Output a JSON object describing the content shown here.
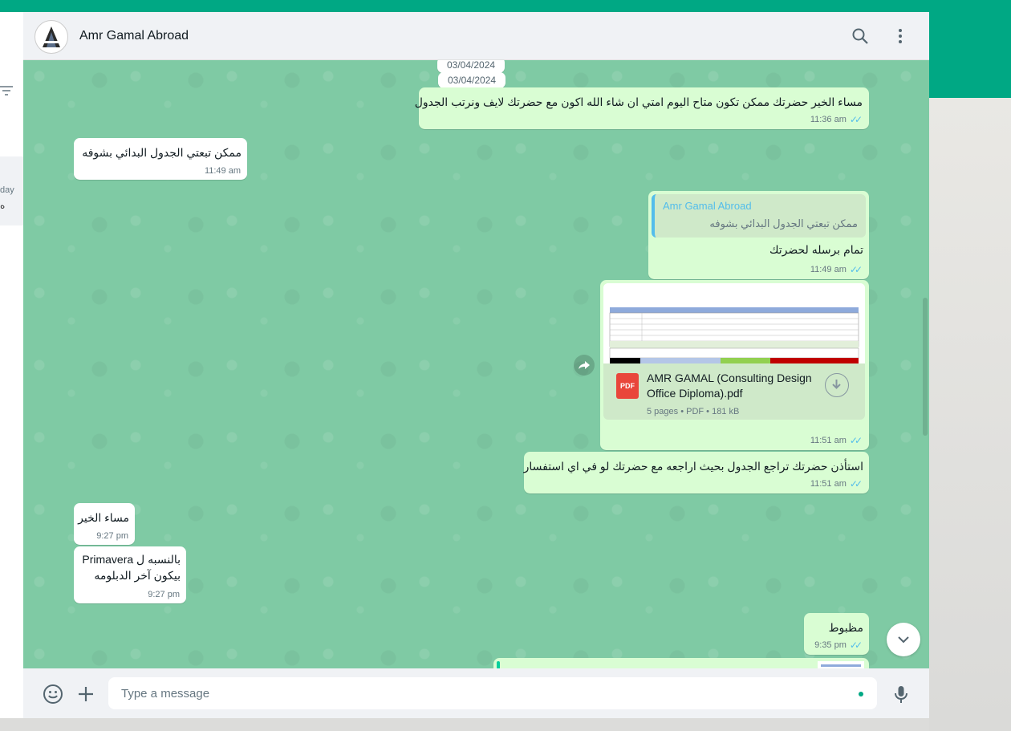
{
  "colors": {
    "brand": "#00a884",
    "chat_bg": "#7fcaa4",
    "outgoing_bubble": "#d9fdd3",
    "incoming_bubble": "#ffffff",
    "read_tick": "#53bdeb"
  },
  "sidebar_clip": {
    "text1": "day",
    "text2": "ه"
  },
  "header": {
    "contact_name": "Amr Gamal Abroad",
    "icons": [
      "search-icon",
      "menu-icon"
    ]
  },
  "chat": {
    "sticky_date": "03/04/2024",
    "date_chip": "03/04/2024",
    "messages": [
      {
        "dir": "out",
        "text": "مساء الخير حضرتك ممكن تكون متاح اليوم امتي ان شاء الله اكون مع حضرتك لايف ونرتب الجدول",
        "time": "11:36 am"
      },
      {
        "dir": "in",
        "text": "ممكن تبعتي الجدول البدائي بشوفه",
        "time": "11:49 am"
      },
      {
        "dir": "out",
        "reply": {
          "name": "Amr Gamal Abroad",
          "text": "ممكن تبعتي الجدول البدائي بشوفه"
        },
        "text": "تمام برسله لحضرتك",
        "time": "11:49 am"
      },
      {
        "dir": "out",
        "document": {
          "file_name": "AMR GAMAL (Consulting Design Office Diploma).pdf",
          "info": "5 pages • PDF • 181 kB",
          "icon_label": "PDF"
        },
        "time": "11:51 am"
      },
      {
        "dir": "out",
        "text": "استأذن حضرتك تراجع الجدول بحيث اراجعه مع حضرتك لو في اي استفسار",
        "time": "11:51 am"
      },
      {
        "dir": "in",
        "text": "مساء الخير",
        "time": "9:27 pm"
      },
      {
        "dir": "in",
        "lines": [
          "بالنسبه ل Primavera",
          "بيكون آخر الدبلومه"
        ],
        "time": "9:27 pm"
      },
      {
        "dir": "out",
        "text": "مظبوط",
        "time": "9:35 pm"
      }
    ]
  },
  "footer": {
    "placeholder": "Type a message",
    "icons": [
      "emoji-icon",
      "attach-plus-icon",
      "microphone-icon"
    ]
  }
}
